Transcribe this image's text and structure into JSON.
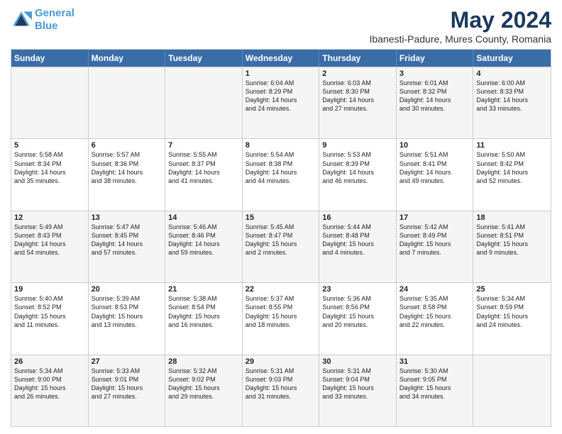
{
  "logo": {
    "line1": "General",
    "line2": "Blue"
  },
  "header": {
    "month": "May 2024",
    "location": "Ibanesti-Padure, Mures County, Romania"
  },
  "days": [
    "Sunday",
    "Monday",
    "Tuesday",
    "Wednesday",
    "Thursday",
    "Friday",
    "Saturday"
  ],
  "rows": [
    [
      {
        "num": "",
        "lines": []
      },
      {
        "num": "",
        "lines": []
      },
      {
        "num": "",
        "lines": []
      },
      {
        "num": "1",
        "lines": [
          "Sunrise: 6:04 AM",
          "Sunset: 8:29 PM",
          "Daylight: 14 hours",
          "and 24 minutes."
        ]
      },
      {
        "num": "2",
        "lines": [
          "Sunrise: 6:03 AM",
          "Sunset: 8:30 PM",
          "Daylight: 14 hours",
          "and 27 minutes."
        ]
      },
      {
        "num": "3",
        "lines": [
          "Sunrise: 6:01 AM",
          "Sunset: 8:32 PM",
          "Daylight: 14 hours",
          "and 30 minutes."
        ]
      },
      {
        "num": "4",
        "lines": [
          "Sunrise: 6:00 AM",
          "Sunset: 8:33 PM",
          "Daylight: 14 hours",
          "and 33 minutes."
        ]
      }
    ],
    [
      {
        "num": "5",
        "lines": [
          "Sunrise: 5:58 AM",
          "Sunset: 8:34 PM",
          "Daylight: 14 hours",
          "and 35 minutes."
        ]
      },
      {
        "num": "6",
        "lines": [
          "Sunrise: 5:57 AM",
          "Sunset: 8:36 PM",
          "Daylight: 14 hours",
          "and 38 minutes."
        ]
      },
      {
        "num": "7",
        "lines": [
          "Sunrise: 5:55 AM",
          "Sunset: 8:37 PM",
          "Daylight: 14 hours",
          "and 41 minutes."
        ]
      },
      {
        "num": "8",
        "lines": [
          "Sunrise: 5:54 AM",
          "Sunset: 8:38 PM",
          "Daylight: 14 hours",
          "and 44 minutes."
        ]
      },
      {
        "num": "9",
        "lines": [
          "Sunrise: 5:53 AM",
          "Sunset: 8:39 PM",
          "Daylight: 14 hours",
          "and 46 minutes."
        ]
      },
      {
        "num": "10",
        "lines": [
          "Sunrise: 5:51 AM",
          "Sunset: 8:41 PM",
          "Daylight: 14 hours",
          "and 49 minutes."
        ]
      },
      {
        "num": "11",
        "lines": [
          "Sunrise: 5:50 AM",
          "Sunset: 8:42 PM",
          "Daylight: 14 hours",
          "and 52 minutes."
        ]
      }
    ],
    [
      {
        "num": "12",
        "lines": [
          "Sunrise: 5:49 AM",
          "Sunset: 8:43 PM",
          "Daylight: 14 hours",
          "and 54 minutes."
        ]
      },
      {
        "num": "13",
        "lines": [
          "Sunrise: 5:47 AM",
          "Sunset: 8:45 PM",
          "Daylight: 14 hours",
          "and 57 minutes."
        ]
      },
      {
        "num": "14",
        "lines": [
          "Sunrise: 5:46 AM",
          "Sunset: 8:46 PM",
          "Daylight: 14 hours",
          "and 59 minutes."
        ]
      },
      {
        "num": "15",
        "lines": [
          "Sunrise: 5:45 AM",
          "Sunset: 8:47 PM",
          "Daylight: 15 hours",
          "and 2 minutes."
        ]
      },
      {
        "num": "16",
        "lines": [
          "Sunrise: 5:44 AM",
          "Sunset: 8:48 PM",
          "Daylight: 15 hours",
          "and 4 minutes."
        ]
      },
      {
        "num": "17",
        "lines": [
          "Sunrise: 5:42 AM",
          "Sunset: 8:49 PM",
          "Daylight: 15 hours",
          "and 7 minutes."
        ]
      },
      {
        "num": "18",
        "lines": [
          "Sunrise: 5:41 AM",
          "Sunset: 8:51 PM",
          "Daylight: 15 hours",
          "and 9 minutes."
        ]
      }
    ],
    [
      {
        "num": "19",
        "lines": [
          "Sunrise: 5:40 AM",
          "Sunset: 8:52 PM",
          "Daylight: 15 hours",
          "and 11 minutes."
        ]
      },
      {
        "num": "20",
        "lines": [
          "Sunrise: 5:39 AM",
          "Sunset: 8:53 PM",
          "Daylight: 15 hours",
          "and 13 minutes."
        ]
      },
      {
        "num": "21",
        "lines": [
          "Sunrise: 5:38 AM",
          "Sunset: 8:54 PM",
          "Daylight: 15 hours",
          "and 16 minutes."
        ]
      },
      {
        "num": "22",
        "lines": [
          "Sunrise: 5:37 AM",
          "Sunset: 8:55 PM",
          "Daylight: 15 hours",
          "and 18 minutes."
        ]
      },
      {
        "num": "23",
        "lines": [
          "Sunrise: 5:36 AM",
          "Sunset: 8:56 PM",
          "Daylight: 15 hours",
          "and 20 minutes."
        ]
      },
      {
        "num": "24",
        "lines": [
          "Sunrise: 5:35 AM",
          "Sunset: 8:58 PM",
          "Daylight: 15 hours",
          "and 22 minutes."
        ]
      },
      {
        "num": "25",
        "lines": [
          "Sunrise: 5:34 AM",
          "Sunset: 8:59 PM",
          "Daylight: 15 hours",
          "and 24 minutes."
        ]
      }
    ],
    [
      {
        "num": "26",
        "lines": [
          "Sunrise: 5:34 AM",
          "Sunset: 9:00 PM",
          "Daylight: 15 hours",
          "and 26 minutes."
        ]
      },
      {
        "num": "27",
        "lines": [
          "Sunrise: 5:33 AM",
          "Sunset: 9:01 PM",
          "Daylight: 15 hours",
          "and 27 minutes."
        ]
      },
      {
        "num": "28",
        "lines": [
          "Sunrise: 5:32 AM",
          "Sunset: 9:02 PM",
          "Daylight: 15 hours",
          "and 29 minutes."
        ]
      },
      {
        "num": "29",
        "lines": [
          "Sunrise: 5:31 AM",
          "Sunset: 9:03 PM",
          "Daylight: 15 hours",
          "and 31 minutes."
        ]
      },
      {
        "num": "30",
        "lines": [
          "Sunrise: 5:31 AM",
          "Sunset: 9:04 PM",
          "Daylight: 15 hours",
          "and 33 minutes."
        ]
      },
      {
        "num": "31",
        "lines": [
          "Sunrise: 5:30 AM",
          "Sunset: 9:05 PM",
          "Daylight: 15 hours",
          "and 34 minutes."
        ]
      },
      {
        "num": "",
        "lines": []
      }
    ]
  ],
  "alt_rows": [
    0,
    2,
    4
  ],
  "colors": {
    "header_bg": "#3a6da8",
    "alt_bg": "#f5f5f5",
    "border": "#cccccc"
  }
}
